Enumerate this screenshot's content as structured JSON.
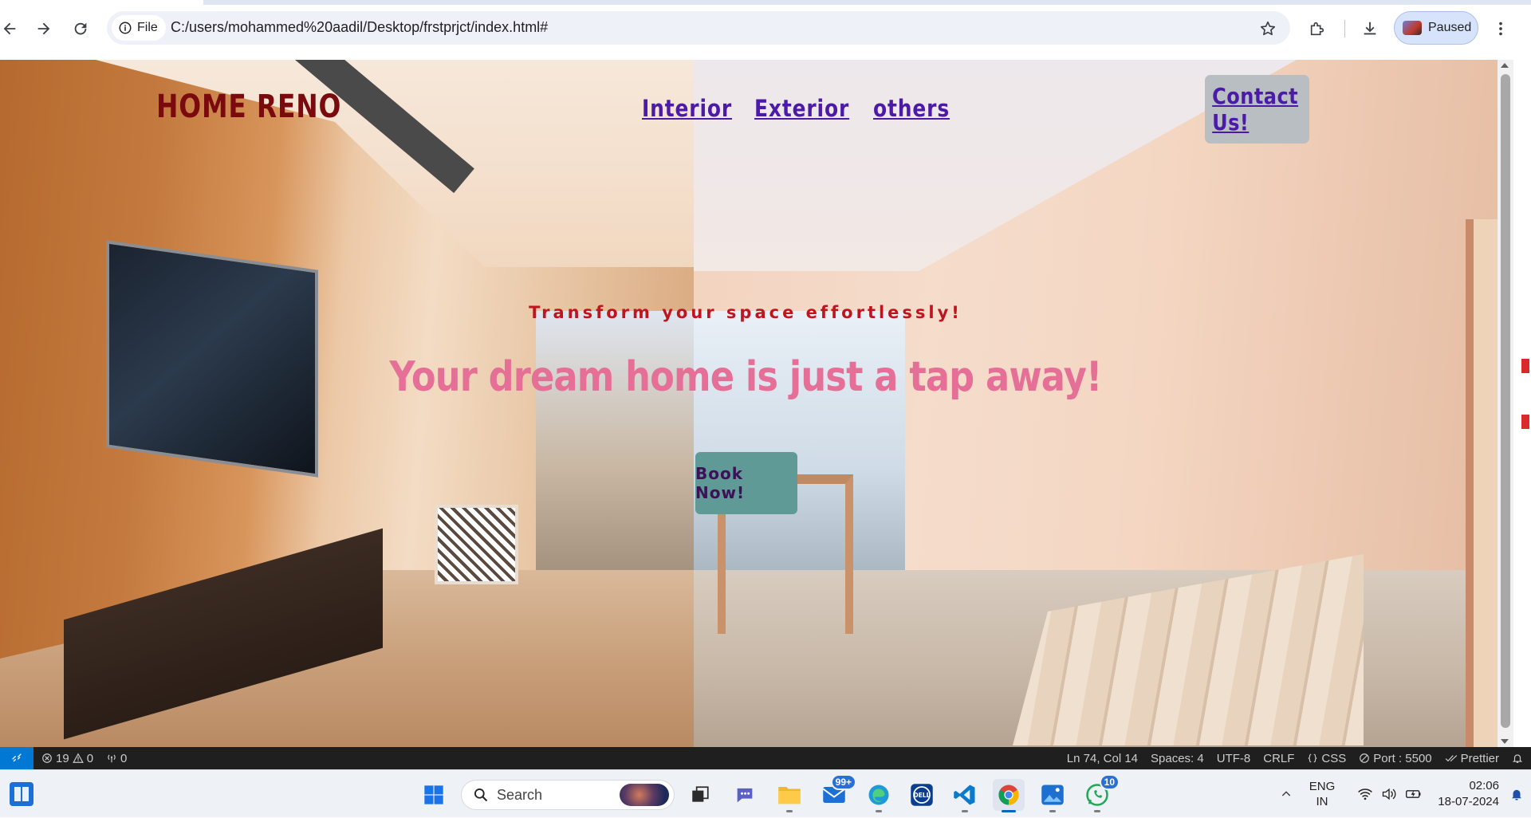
{
  "browser": {
    "site_info_label": "File",
    "url": "C:/users/mohammed%20aadil/Desktop/frstprjct/index.html#",
    "profile_label": "Paused"
  },
  "site": {
    "logo": "HOME RENO",
    "nav": [
      "Interior",
      "Exterior",
      "others"
    ],
    "contact_label": "Contact Us!",
    "tagline": "Transform your space effortlessly!",
    "headline": "Your dream home is just a tap away!",
    "book_label": "Book Now!"
  },
  "statusbar": {
    "errors": "19",
    "warnings": "0",
    "ports_count": "0",
    "cursor": "Ln 74, Col 14",
    "spaces": "Spaces: 4",
    "encoding": "UTF-8",
    "eol": "CRLF",
    "language": "CSS",
    "port": "Port : 5500",
    "formatter": "Prettier"
  },
  "taskbar": {
    "search_placeholder": "Search",
    "mail_badge": "99+",
    "whatsapp_badge": "10",
    "lang_line1": "ENG",
    "lang_line2": "IN",
    "time": "02:06",
    "date": "18-07-2024"
  },
  "colors": {
    "logo": "#7a0a0e",
    "nav_link": "#4b1aa8",
    "tagline": "#c0141f",
    "headline": "#e56f96",
    "book_button_bg": "#5f9a97",
    "contact_button_bg": "#b9bec3",
    "statusbar_bg": "#1f1f1f",
    "remote_btn_bg": "#0078d4"
  }
}
